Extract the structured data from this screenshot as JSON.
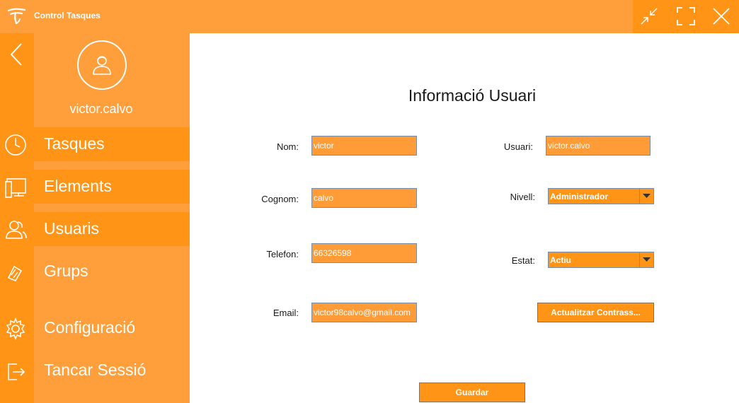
{
  "app": {
    "title": "Control Tasques",
    "logo_icon": "app-logo-icon"
  },
  "window_controls": [
    {
      "name": "minimize",
      "icon": "collapse-arrows-icon"
    },
    {
      "name": "maximize",
      "icon": "fullscreen-corners-icon"
    },
    {
      "name": "close",
      "icon": "close-icon"
    }
  ],
  "sidebar": {
    "back_icon": "chevron-left-icon",
    "username": "victor.calvo",
    "avatar_icon": "user-avatar-icon",
    "items": [
      {
        "label": "Tasques",
        "icon": "clock-icon",
        "active": true
      },
      {
        "label": "Elements",
        "icon": "monitor-icon",
        "active": true
      },
      {
        "label": "Usuaris",
        "icon": "users-icon",
        "active": true
      },
      {
        "label": "Grups",
        "icon": "groups-icon",
        "active": false
      },
      {
        "label": "Configuració",
        "icon": "gear-icon",
        "active": false
      },
      {
        "label": "Tancar Sessió",
        "icon": "logout-icon",
        "active": false
      }
    ]
  },
  "form": {
    "title": "Informació Usuari",
    "nom": {
      "label": "Nom:",
      "value": "victor"
    },
    "cognom": {
      "label": "Cognom:",
      "value": "calvo"
    },
    "telefon": {
      "label": "Telefon:",
      "value": "66326598"
    },
    "email": {
      "label": "Email:",
      "value": "victor98calvo@gmail.com"
    },
    "usuari": {
      "label": "Usuari:",
      "value": "victor.calvo"
    },
    "nivell": {
      "label": "Nivell:",
      "value": "Administrador"
    },
    "estat": {
      "label": "Estat:",
      "value": "Actiu"
    },
    "update_password_label": "Actualitzar Contrass...",
    "save_label": "Guardar"
  },
  "colors": {
    "accent": "#ff9f3c",
    "accent_dark": "#ff9416",
    "text": "#1a1a1a",
    "border": "#7a8da6"
  }
}
